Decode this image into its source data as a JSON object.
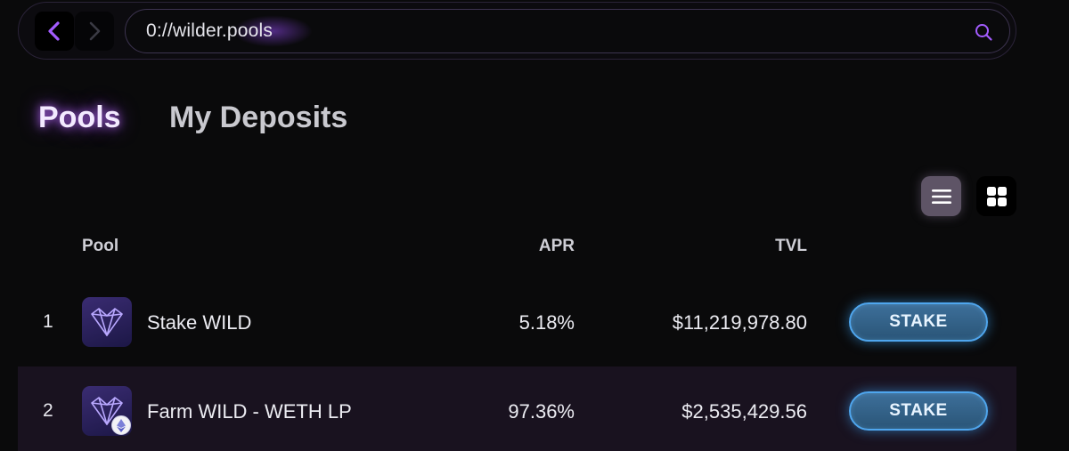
{
  "address_bar": {
    "url": "0://wilder.pools",
    "back_icon": "chevron-left-icon",
    "forward_icon": "chevron-right-icon",
    "search_icon": "search-icon"
  },
  "tabs": [
    {
      "label": "Pools",
      "active": true
    },
    {
      "label": "My Deposits",
      "active": false
    }
  ],
  "view_toggle": {
    "list_icon": "list-icon",
    "grid_icon": "grid-icon",
    "active": "list"
  },
  "table": {
    "headers": {
      "pool": "Pool",
      "apr": "APR",
      "tvl": "TVL"
    },
    "rows": [
      {
        "rank": "1",
        "name": "Stake WILD",
        "apr": "5.18%",
        "tvl": "$11,219,978.80",
        "action": "STAKE",
        "icon": "wild-logo-icon"
      },
      {
        "rank": "2",
        "name": "Farm WILD - WETH LP",
        "apr": "97.36%",
        "tvl": "$2,535,429.56",
        "action": "STAKE",
        "icon": "wild-logo-icon",
        "badge": "ethereum-icon"
      }
    ]
  },
  "colors": {
    "accent_purple": "#a35cff",
    "stake_button_blue": "#4fa6ee",
    "row_highlight": "#19121f",
    "background": "#0a0a0b"
  }
}
